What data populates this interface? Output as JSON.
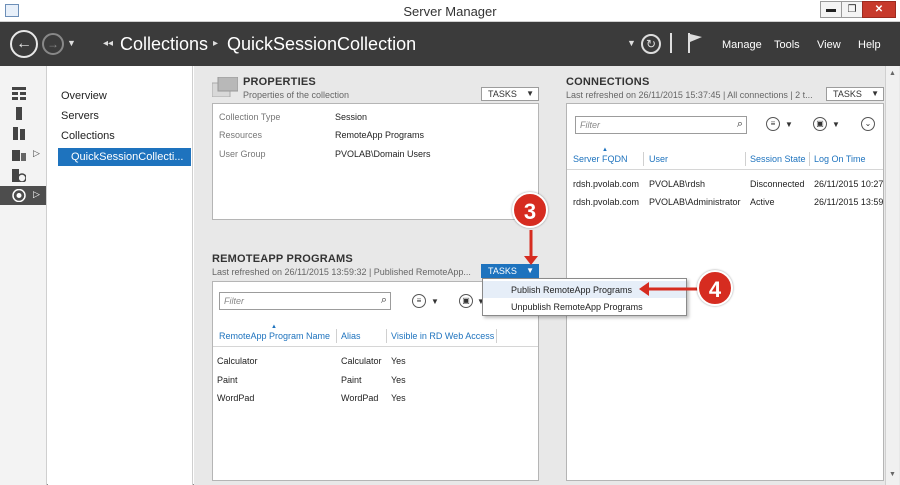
{
  "window": {
    "title": "Server Manager",
    "minimize": "▬",
    "restore": "❐",
    "close": "✕"
  },
  "header": {
    "back_icon": "←",
    "forward_icon": "→",
    "breadcrumb_root": "Collections",
    "breadcrumb_current": "QuickSessionCollection",
    "menu": [
      "Manage",
      "Tools",
      "View",
      "Help"
    ]
  },
  "nav": {
    "items": [
      "Overview",
      "Servers",
      "Collections"
    ],
    "selected": "QuickSessionCollecti..."
  },
  "properties": {
    "title": "PROPERTIES",
    "subtitle": "Properties of the collection",
    "tasks": "TASKS",
    "rows": [
      {
        "key": "Collection Type",
        "value": "Session"
      },
      {
        "key": "Resources",
        "value": "RemoteApp Programs"
      },
      {
        "key": "User Group",
        "value": "PVOLAB\\Domain Users"
      }
    ]
  },
  "remoteapp": {
    "title": "REMOTEAPP PROGRAMS",
    "subtitle": "Last refreshed on 26/11/2015 13:59:32 | Published RemoteApp...",
    "tasks": "TASKS",
    "filter_placeholder": "Filter",
    "columns": [
      "RemoteApp Program Name",
      "Alias",
      "Visible in RD Web Access"
    ],
    "rows": [
      [
        "Calculator",
        "Calculator",
        "Yes"
      ],
      [
        "Paint",
        "Paint",
        "Yes"
      ],
      [
        "WordPad",
        "WordPad",
        "Yes"
      ]
    ]
  },
  "tasks_menu": {
    "items": [
      "Publish RemoteApp Programs",
      "Unpublish RemoteApp Programs"
    ]
  },
  "connections": {
    "title": "CONNECTIONS",
    "subtitle": "Last refreshed on 26/11/2015 15:37:45 | All connections | 2 t...",
    "tasks": "TASKS",
    "filter_placeholder": "Filter",
    "columns": [
      "Server FQDN",
      "User",
      "Session State",
      "Log On Time"
    ],
    "rows": [
      [
        "rdsh.pvolab.com",
        "PVOLAB\\rdsh",
        "Disconnected",
        "26/11/2015 10:27"
      ],
      [
        "rdsh.pvolab.com",
        "PVOLAB\\Administrator",
        "Active",
        "26/11/2015 13:59"
      ]
    ]
  },
  "callouts": {
    "step3": "3",
    "step4": "4"
  },
  "colors": {
    "accent": "#1e73be",
    "header": "#3b3b3b",
    "callout": "#d62c20"
  }
}
